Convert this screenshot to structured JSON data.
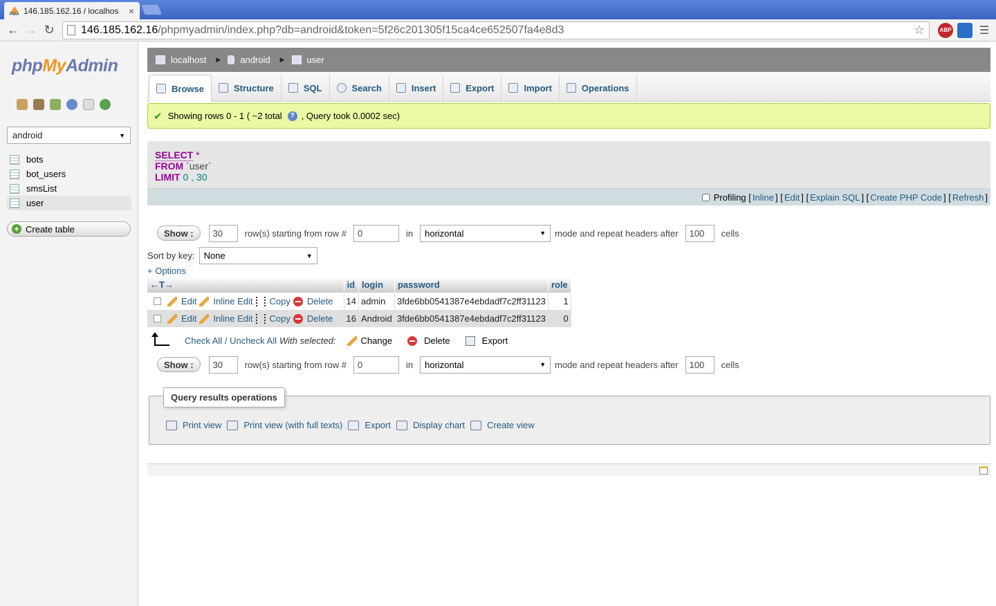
{
  "browser": {
    "tab_title": "146.185.162.16 / localhos",
    "favicon_text": "PMA",
    "url_host": "146.185.162.16",
    "url_path": "/phpmyadmin/index.php?db=android&token=5f26c201305f15ca4ce652507fa4e8d3",
    "abp_label": "ABP"
  },
  "sidebar": {
    "logo_php": "php",
    "logo_my": "My",
    "logo_admin": "Admin",
    "db_selected": "android",
    "tables": [
      {
        "label": "bots"
      },
      {
        "label": "bot_users"
      },
      {
        "label": "smsList"
      },
      {
        "label": "user"
      }
    ],
    "create_table": "Create table"
  },
  "breadcrumb": {
    "server": "localhost",
    "database": "android",
    "table": "user"
  },
  "tabs": [
    {
      "label": "Browse"
    },
    {
      "label": "Structure"
    },
    {
      "label": "SQL"
    },
    {
      "label": "Search"
    },
    {
      "label": "Insert"
    },
    {
      "label": "Export"
    },
    {
      "label": "Import"
    },
    {
      "label": "Operations"
    }
  ],
  "message": {
    "text_before": "Showing rows 0 - 1 ( ~2 total",
    "text_after": ", Query took 0.0002 sec)"
  },
  "sql": {
    "select_kw": "SELECT",
    "star": "*",
    "from_kw": "FROM",
    "table": "`user`",
    "limit_kw": "LIMIT",
    "limit_start": "0",
    "comma": ",",
    "limit_count": "30"
  },
  "sql_links": {
    "profiling": "Profiling",
    "inline": "Inline",
    "edit": "Edit",
    "explain": "Explain SQL",
    "create_php": "Create PHP Code",
    "refresh": "Refresh"
  },
  "nav": {
    "show_label": "Show :",
    "rows_count": "30",
    "starting_label": "row(s) starting from row #",
    "start_row": "0",
    "in_label": "in",
    "mode": "horizontal",
    "repeat_label": "mode and repeat headers after",
    "repeat_cells": "100",
    "cells_label": "cells"
  },
  "sort": {
    "label": "Sort by key:",
    "value": "None"
  },
  "options_link": "+ Options",
  "table": {
    "arrows": "←T→",
    "columns": [
      "id",
      "login",
      "password",
      "role"
    ],
    "action_labels": {
      "edit": "Edit",
      "inline_edit": "Inline Edit",
      "copy": "Copy",
      "delete": "Delete"
    },
    "rows": [
      {
        "id": "14",
        "login": "admin",
        "password": "3fde6bb0541387e4ebdadf7c2ff31123",
        "role": "1"
      },
      {
        "id": "16",
        "login": "Android",
        "password": "3fde6bb0541387e4ebdadf7c2ff31123",
        "role": "0"
      }
    ]
  },
  "with_selected": {
    "check_all": "Check All",
    "slash": "/",
    "uncheck_all": "Uncheck All",
    "label": "With selected:",
    "change": "Change",
    "delete": "Delete",
    "export": "Export"
  },
  "query_ops": {
    "legend": "Query results operations",
    "print_view": "Print view",
    "print_full": "Print view (with full texts)",
    "export": "Export",
    "display_chart": "Display chart",
    "create_view": "Create view"
  }
}
